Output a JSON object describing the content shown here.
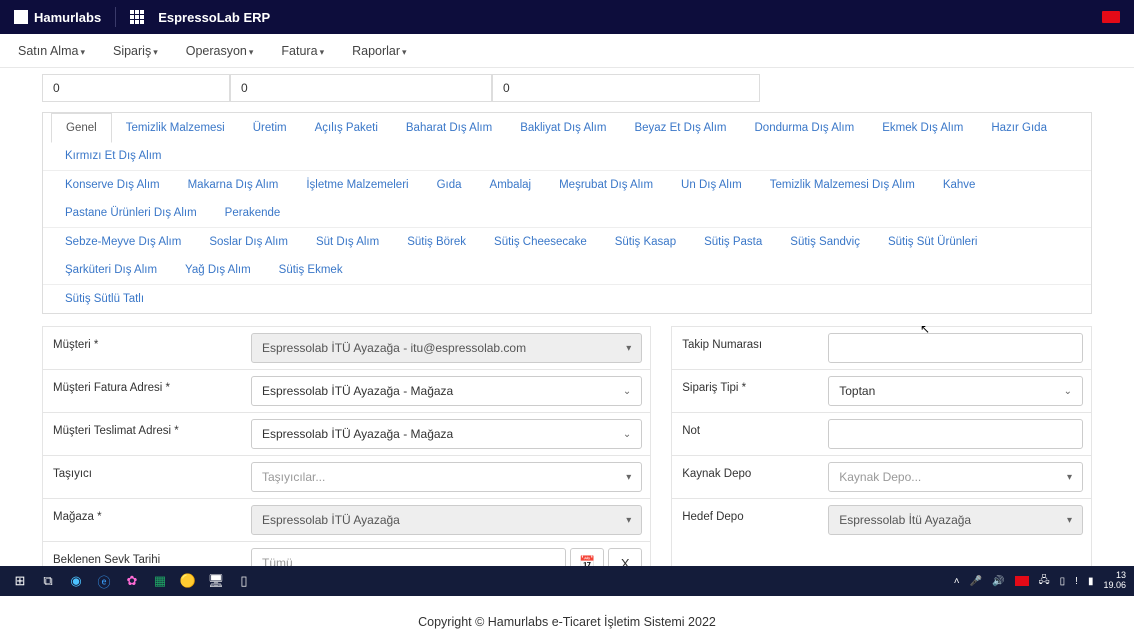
{
  "header": {
    "brand1": "Hamurlabs",
    "brand2": "EspressoLab ERP"
  },
  "menu": [
    "Satın Alma",
    "Sipariş",
    "Operasyon",
    "Fatura",
    "Raporlar"
  ],
  "numbers": {
    "v1": "0",
    "v2": "0",
    "v3": "0"
  },
  "tabs_row1": [
    "Genel",
    "Temizlik Malzemesi",
    "Üretim",
    "Açılış Paketi",
    "Baharat Dış Alım",
    "Bakliyat Dış Alım",
    "Beyaz Et Dış Alım",
    "Dondurma Dış Alım",
    "Ekmek Dış Alım",
    "Hazır Gıda",
    "Kırmızı Et Dış Alım"
  ],
  "tabs_row2": [
    "Konserve Dış Alım",
    "Makarna Dış Alım",
    "İşletme Malzemeleri",
    "Gıda",
    "Ambalaj",
    "Meşrubat Dış Alım",
    "Un Dış Alım",
    "Temizlik Malzemesi Dış Alım",
    "Kahve",
    "Pastane Ürünleri Dış Alım",
    "Perakende"
  ],
  "tabs_row3": [
    "Sebze-Meyve Dış Alım",
    "Soslar Dış Alım",
    "Süt Dış Alım",
    "Sütiş Börek",
    "Sütiş Cheesecake",
    "Sütiş Kasap",
    "Sütiş Pasta",
    "Sütiş Sandviç",
    "Sütiş Süt Ürünleri",
    "Şarküteri Dış Alım",
    "Yağ Dış Alım",
    "Sütiş Ekmek"
  ],
  "tabs_row4": [
    "Sütiş Sütlü Tatlı"
  ],
  "form": {
    "left": {
      "musteri_label": "Müşteri *",
      "musteri_value": "Espressolab İTÜ Ayazağa - itu@espressolab.com",
      "fatura_label": "Müşteri Fatura Adresi *",
      "fatura_value": "Espressolab İTÜ Ayazağa - Mağaza",
      "teslimat_label": "Müşteri Teslimat Adresi *",
      "teslimat_value": "Espressolab İTÜ Ayazağa - Mağaza",
      "tasiyici_label": "Taşıyıcı",
      "tasiyici_placeholder": "Taşıyıcılar...",
      "magaza_label": "Mağaza *",
      "magaza_value": "Espressolab İTÜ Ayazağa",
      "sevk_label": "Beklenen Sevk Tarihi",
      "sevk_placeholder": "Tümü",
      "clear": "X"
    },
    "right": {
      "takip_label": "Takip Numarası",
      "siparis_label": "Sipariş Tipi *",
      "siparis_value": "Toptan",
      "not_label": "Not",
      "kaynak_label": "Kaynak Depo",
      "kaynak_placeholder": "Kaynak Depo...",
      "hedef_label": "Hedef Depo",
      "hedef_value": "Espressolab İtü Ayazağa"
    }
  },
  "footer": "Copyright © Hamurlabs e-Ticaret İşletim Sistemi 2022",
  "taskbar": {
    "time1": "13",
    "time2": "19.06"
  }
}
